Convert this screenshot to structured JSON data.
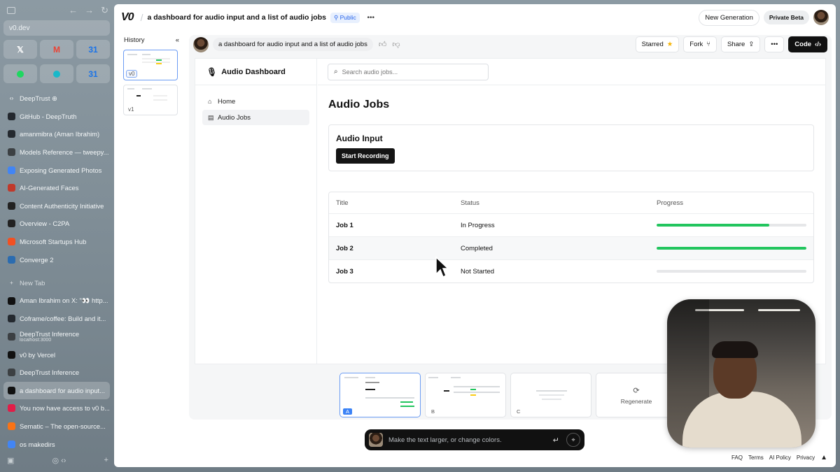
{
  "browser": {
    "url": "v0.dev",
    "pinned": [
      {
        "icon": "x-icon",
        "glyph": "𝕏",
        "color": "#ffffff"
      },
      {
        "icon": "gmail-icon",
        "glyph": "M",
        "color": "#ea4335"
      },
      {
        "icon": "calendar-icon",
        "glyph": "31",
        "color": "#1a73e8"
      },
      {
        "icon": "spotify-icon",
        "glyph": "",
        "color": "#1ed760"
      },
      {
        "icon": "globe-icon",
        "glyph": "",
        "color": "#19b8c9"
      },
      {
        "icon": "calendar-icon",
        "glyph": "31",
        "color": "#1a73e8"
      }
    ],
    "tabs": [
      {
        "icon": "code-icon",
        "label": "DeepTrust ⊕",
        "sub": "",
        "color": ""
      },
      {
        "icon": "github-icon",
        "label": "GitHub - DeepTruth",
        "sub": "",
        "color": "#24292f"
      },
      {
        "icon": "github-icon",
        "label": "amanmibra (Aman Ibrahim)",
        "sub": "",
        "color": "#24292f"
      },
      {
        "icon": "doc-icon",
        "label": "Models Reference — tweepy...",
        "sub": "",
        "color": "#3c4043"
      },
      {
        "icon": "image-icon",
        "label": "Exposing Generated Photos",
        "sub": "",
        "color": "#4285f4"
      },
      {
        "icon": "x-mark-icon",
        "label": "AI-Generated Faces",
        "sub": "",
        "color": "#c0392b"
      },
      {
        "icon": "shield-icon",
        "label": "Content Authenticity Initiative",
        "sub": "",
        "color": "#222"
      },
      {
        "icon": "c2pa-icon",
        "label": "Overview - C2PA",
        "sub": "",
        "color": "#222"
      },
      {
        "icon": "microsoft-icon",
        "label": "Microsoft Startups Hub",
        "sub": "",
        "color": "#f25022"
      },
      {
        "icon": "globe-icon",
        "label": "Converge 2",
        "sub": "",
        "color": "#2b6cb0"
      }
    ],
    "new_tab": "New Tab",
    "tabs2": [
      {
        "icon": "x-icon",
        "label": "Aman Ibrahim on X: \"👀 http...",
        "sub": "",
        "color": "#111"
      },
      {
        "icon": "github-icon",
        "label": "Coframe/coffee: Build and it...",
        "sub": "",
        "color": "#24292f"
      },
      {
        "icon": "doc-icon",
        "label": "DeepTrust Inference",
        "sub": "localhost:3000",
        "color": "#3c4043"
      },
      {
        "icon": "v0-icon",
        "label": "v0 by Vercel",
        "sub": "",
        "color": "#111"
      },
      {
        "icon": "doc-icon",
        "label": "DeepTrust Inference",
        "sub": "",
        "color": "#3c4043"
      },
      {
        "icon": "v0-icon",
        "label": "a dashboard for audio input...",
        "sub": "",
        "color": "#111",
        "selected": true
      },
      {
        "icon": "spark-icon",
        "label": "You now have access to v0 b...",
        "sub": "",
        "color": "#e11d48"
      },
      {
        "icon": "sematic-icon",
        "label": "Sematic – The open-source...",
        "sub": "",
        "color": "#f97316"
      },
      {
        "icon": "google-icon",
        "label": "os makedirs",
        "sub": "",
        "color": "#4285f4"
      }
    ]
  },
  "app": {
    "logo": "V0",
    "project_title": "a dashboard for audio input and a list of audio jobs",
    "visibility": "Public",
    "new_generation": "New Generation",
    "private_beta": "Private Beta",
    "history_label": "History",
    "versions": [
      "v0",
      "v1"
    ],
    "prompt": "a dashboard for audio input and a list of audio jobs",
    "starred": "Starred",
    "fork": "Fork",
    "share": "Share",
    "code": "Code",
    "chat_placeholder": "Make the text larger, or change colors.",
    "variants": [
      "A",
      "B",
      "C"
    ],
    "regenerate": "Regenerate",
    "footer": [
      "FAQ",
      "Terms",
      "AI Policy",
      "Privacy"
    ]
  },
  "preview": {
    "brand": "Audio Dashboard",
    "nav": [
      {
        "label": "Home",
        "icon": "home-icon",
        "active": false
      },
      {
        "label": "Audio Jobs",
        "icon": "file-audio-icon",
        "active": true
      }
    ],
    "search_placeholder": "Search audio jobs...",
    "heading": "Audio Jobs",
    "card_title": "Audio Input",
    "record_button": "Start Recording",
    "columns": [
      "Title",
      "Status",
      "Progress"
    ],
    "jobs": [
      {
        "title": "Job 1",
        "status": "In Progress",
        "progress": 0.75
      },
      {
        "title": "Job 2",
        "status": "Completed",
        "progress": 1.0
      },
      {
        "title": "Job 3",
        "status": "Not Started",
        "progress": 0.0
      }
    ],
    "progress_color": "#22c55e"
  }
}
